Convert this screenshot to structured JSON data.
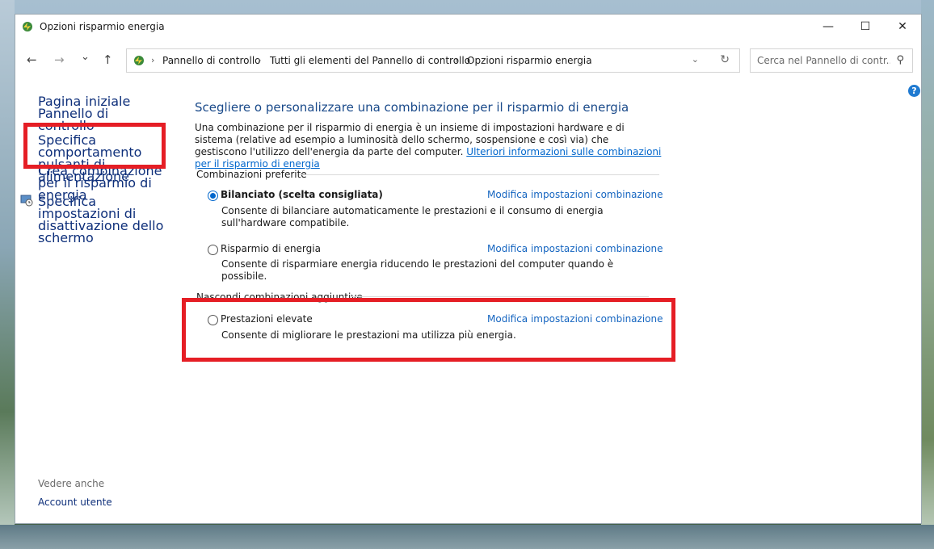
{
  "window": {
    "title": "Opzioni risparmio energia",
    "controls": {
      "minimize": "—",
      "maximize": "☐",
      "close": "✕"
    }
  },
  "nav": {
    "back": "←",
    "forward": "→",
    "recent": "⌄",
    "up": "↑",
    "breadcrumbs": [
      "Pannello di controllo",
      "Tutti gli elementi del Pannello di controllo",
      "Opzioni risparmio energia"
    ],
    "search_placeholder": "Cerca nel Pannello di contr..."
  },
  "sidebar": {
    "home_link": "Pagina iniziale Pannello di controllo",
    "items": [
      "Specifica comportamento pulsanti di alimentazione",
      "Crea combinazione per il risparmio di energia",
      "Specifica impostazioni di disattivazione dello schermo"
    ],
    "see_also_label": "Vedere anche",
    "see_also_links": [
      "Account utente"
    ]
  },
  "main": {
    "heading": "Scegliere o personalizzare una combinazione per il risparmio di energia",
    "intro_text": "Una combinazione per il risparmio di energia è un insieme di impostazioni hardware e di sistema (relative ad esempio a luminosità dello schermo, sospensione e così via) che gestiscono l'utilizzo dell'energia da parte del computer.",
    "intro_link": "Ulteriori informazioni sulle combinazioni per il risparmio di energia",
    "preferred_group_label": "Combinazioni preferite",
    "hidden_group_label": "Nascondi combinazioni aggiuntive",
    "plans": [
      {
        "name": "Bilanciato (scelta consigliata)",
        "selected": true,
        "description": "Consente di bilanciare automaticamente le prestazioni e il consumo di energia sull'hardware compatibile.",
        "link": "Modifica impostazioni combinazione"
      },
      {
        "name": "Risparmio di energia",
        "selected": false,
        "description": "Consente di risparmiare energia riducendo le prestazioni del computer quando è possibile.",
        "link": "Modifica impostazioni combinazione"
      },
      {
        "name": "Prestazioni elevate",
        "selected": false,
        "description": "Consente di migliorare le prestazioni ma utilizza più energia.",
        "link": "Modifica impostazioni combinazione"
      }
    ]
  },
  "colors": {
    "highlight": "#e51e25",
    "link": "#1565c0",
    "heading": "#1a4a8a"
  }
}
